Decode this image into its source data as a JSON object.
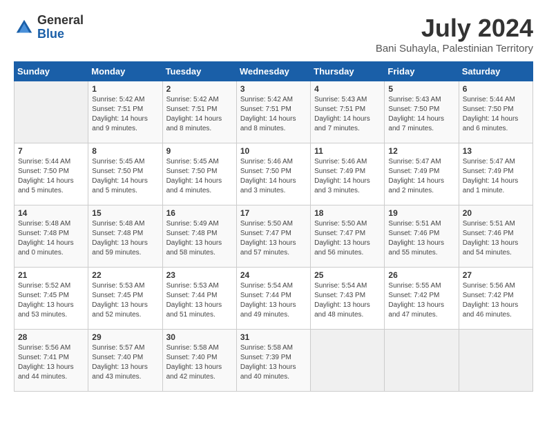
{
  "header": {
    "logo_general": "General",
    "logo_blue": "Blue",
    "title": "July 2024",
    "location": "Bani Suhayla, Palestinian Territory"
  },
  "days_of_week": [
    "Sunday",
    "Monday",
    "Tuesday",
    "Wednesday",
    "Thursday",
    "Friday",
    "Saturday"
  ],
  "weeks": [
    [
      {
        "day": "",
        "sunrise": "",
        "sunset": "",
        "daylight": "",
        "empty": true
      },
      {
        "day": "1",
        "sunrise": "5:42 AM",
        "sunset": "7:51 PM",
        "daylight": "14 hours and 9 minutes."
      },
      {
        "day": "2",
        "sunrise": "5:42 AM",
        "sunset": "7:51 PM",
        "daylight": "14 hours and 8 minutes."
      },
      {
        "day": "3",
        "sunrise": "5:42 AM",
        "sunset": "7:51 PM",
        "daylight": "14 hours and 8 minutes."
      },
      {
        "day": "4",
        "sunrise": "5:43 AM",
        "sunset": "7:51 PM",
        "daylight": "14 hours and 7 minutes."
      },
      {
        "day": "5",
        "sunrise": "5:43 AM",
        "sunset": "7:50 PM",
        "daylight": "14 hours and 7 minutes."
      },
      {
        "day": "6",
        "sunrise": "5:44 AM",
        "sunset": "7:50 PM",
        "daylight": "14 hours and 6 minutes."
      }
    ],
    [
      {
        "day": "7",
        "sunrise": "5:44 AM",
        "sunset": "7:50 PM",
        "daylight": "14 hours and 5 minutes."
      },
      {
        "day": "8",
        "sunrise": "5:45 AM",
        "sunset": "7:50 PM",
        "daylight": "14 hours and 5 minutes."
      },
      {
        "day": "9",
        "sunrise": "5:45 AM",
        "sunset": "7:50 PM",
        "daylight": "14 hours and 4 minutes."
      },
      {
        "day": "10",
        "sunrise": "5:46 AM",
        "sunset": "7:50 PM",
        "daylight": "14 hours and 3 minutes."
      },
      {
        "day": "11",
        "sunrise": "5:46 AM",
        "sunset": "7:49 PM",
        "daylight": "14 hours and 3 minutes."
      },
      {
        "day": "12",
        "sunrise": "5:47 AM",
        "sunset": "7:49 PM",
        "daylight": "14 hours and 2 minutes."
      },
      {
        "day": "13",
        "sunrise": "5:47 AM",
        "sunset": "7:49 PM",
        "daylight": "14 hours and 1 minute."
      }
    ],
    [
      {
        "day": "14",
        "sunrise": "5:48 AM",
        "sunset": "7:48 PM",
        "daylight": "14 hours and 0 minutes."
      },
      {
        "day": "15",
        "sunrise": "5:48 AM",
        "sunset": "7:48 PM",
        "daylight": "13 hours and 59 minutes."
      },
      {
        "day": "16",
        "sunrise": "5:49 AM",
        "sunset": "7:48 PM",
        "daylight": "13 hours and 58 minutes."
      },
      {
        "day": "17",
        "sunrise": "5:50 AM",
        "sunset": "7:47 PM",
        "daylight": "13 hours and 57 minutes."
      },
      {
        "day": "18",
        "sunrise": "5:50 AM",
        "sunset": "7:47 PM",
        "daylight": "13 hours and 56 minutes."
      },
      {
        "day": "19",
        "sunrise": "5:51 AM",
        "sunset": "7:46 PM",
        "daylight": "13 hours and 55 minutes."
      },
      {
        "day": "20",
        "sunrise": "5:51 AM",
        "sunset": "7:46 PM",
        "daylight": "13 hours and 54 minutes."
      }
    ],
    [
      {
        "day": "21",
        "sunrise": "5:52 AM",
        "sunset": "7:45 PM",
        "daylight": "13 hours and 53 minutes."
      },
      {
        "day": "22",
        "sunrise": "5:53 AM",
        "sunset": "7:45 PM",
        "daylight": "13 hours and 52 minutes."
      },
      {
        "day": "23",
        "sunrise": "5:53 AM",
        "sunset": "7:44 PM",
        "daylight": "13 hours and 51 minutes."
      },
      {
        "day": "24",
        "sunrise": "5:54 AM",
        "sunset": "7:44 PM",
        "daylight": "13 hours and 49 minutes."
      },
      {
        "day": "25",
        "sunrise": "5:54 AM",
        "sunset": "7:43 PM",
        "daylight": "13 hours and 48 minutes."
      },
      {
        "day": "26",
        "sunrise": "5:55 AM",
        "sunset": "7:42 PM",
        "daylight": "13 hours and 47 minutes."
      },
      {
        "day": "27",
        "sunrise": "5:56 AM",
        "sunset": "7:42 PM",
        "daylight": "13 hours and 46 minutes."
      }
    ],
    [
      {
        "day": "28",
        "sunrise": "5:56 AM",
        "sunset": "7:41 PM",
        "daylight": "13 hours and 44 minutes."
      },
      {
        "day": "29",
        "sunrise": "5:57 AM",
        "sunset": "7:40 PM",
        "daylight": "13 hours and 43 minutes."
      },
      {
        "day": "30",
        "sunrise": "5:58 AM",
        "sunset": "7:40 PM",
        "daylight": "13 hours and 42 minutes."
      },
      {
        "day": "31",
        "sunrise": "5:58 AM",
        "sunset": "7:39 PM",
        "daylight": "13 hours and 40 minutes."
      },
      {
        "day": "",
        "sunrise": "",
        "sunset": "",
        "daylight": "",
        "empty": true
      },
      {
        "day": "",
        "sunrise": "",
        "sunset": "",
        "daylight": "",
        "empty": true
      },
      {
        "day": "",
        "sunrise": "",
        "sunset": "",
        "daylight": "",
        "empty": true
      }
    ]
  ],
  "labels": {
    "sunrise": "Sunrise:",
    "sunset": "Sunset:",
    "daylight": "Daylight:"
  }
}
